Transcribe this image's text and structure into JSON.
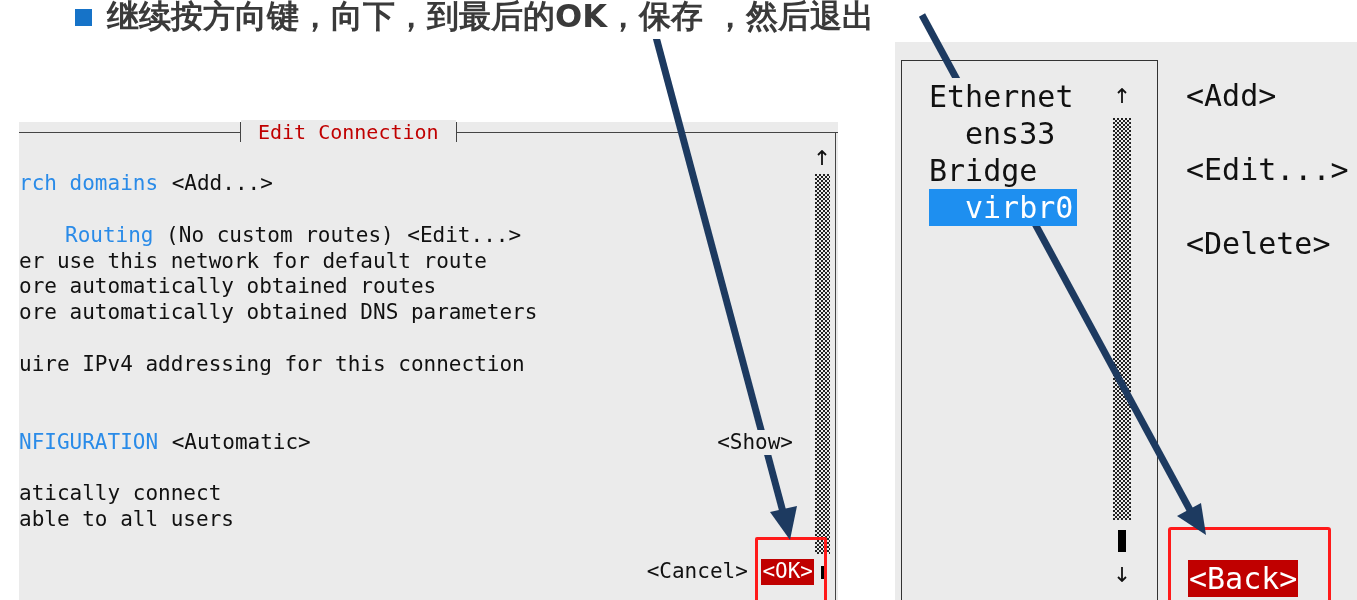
{
  "heading": {
    "text": "继续按方向键，向下，到最后的OK，保存 ，然后退出"
  },
  "edit_connection": {
    "title": "Edit Connection",
    "lines": [
      {
        "kind": "field",
        "label": "rch domains",
        "button": "<Add...>"
      },
      {
        "kind": "spacer"
      },
      {
        "kind": "sub",
        "label": "Routing",
        "text": "(No custom routes)",
        "button": "<Edit...>"
      },
      {
        "kind": "text",
        "text": "er use this network for default route"
      },
      {
        "kind": "text",
        "text": "ore automatically obtained routes"
      },
      {
        "kind": "text",
        "text": "ore automatically obtained DNS parameters"
      },
      {
        "kind": "spacer"
      },
      {
        "kind": "text",
        "text": "uire IPv4 addressing for this connection"
      },
      {
        "kind": "spacer"
      },
      {
        "kind": "spacer"
      },
      {
        "kind": "field",
        "label": "NFIGURATION",
        "button": "<Automatic>",
        "right_button": "<Show>"
      },
      {
        "kind": "spacer"
      },
      {
        "kind": "text",
        "text": "atically connect"
      },
      {
        "kind": "text",
        "text": "able to all users"
      },
      {
        "kind": "spacer"
      },
      {
        "kind": "buttons",
        "buttons": [
          {
            "label": "<Cancel>",
            "selected": false
          },
          {
            "label": "<OK>",
            "selected": true
          }
        ]
      }
    ]
  },
  "connections": {
    "tree": [
      {
        "label": "Ethernet",
        "selected": false,
        "children": [
          {
            "label": "ens33",
            "selected": false
          }
        ]
      },
      {
        "label": "Bridge",
        "selected": false,
        "children": [
          {
            "label": "virbr0",
            "selected": true
          }
        ]
      }
    ],
    "buttons": [
      {
        "label": "<Add>",
        "selected": false
      },
      {
        "label": "<Edit...>",
        "selected": false
      },
      {
        "label": "<Delete>",
        "selected": false
      }
    ],
    "back_button": {
      "label": "<Back>",
      "selected": true
    }
  }
}
